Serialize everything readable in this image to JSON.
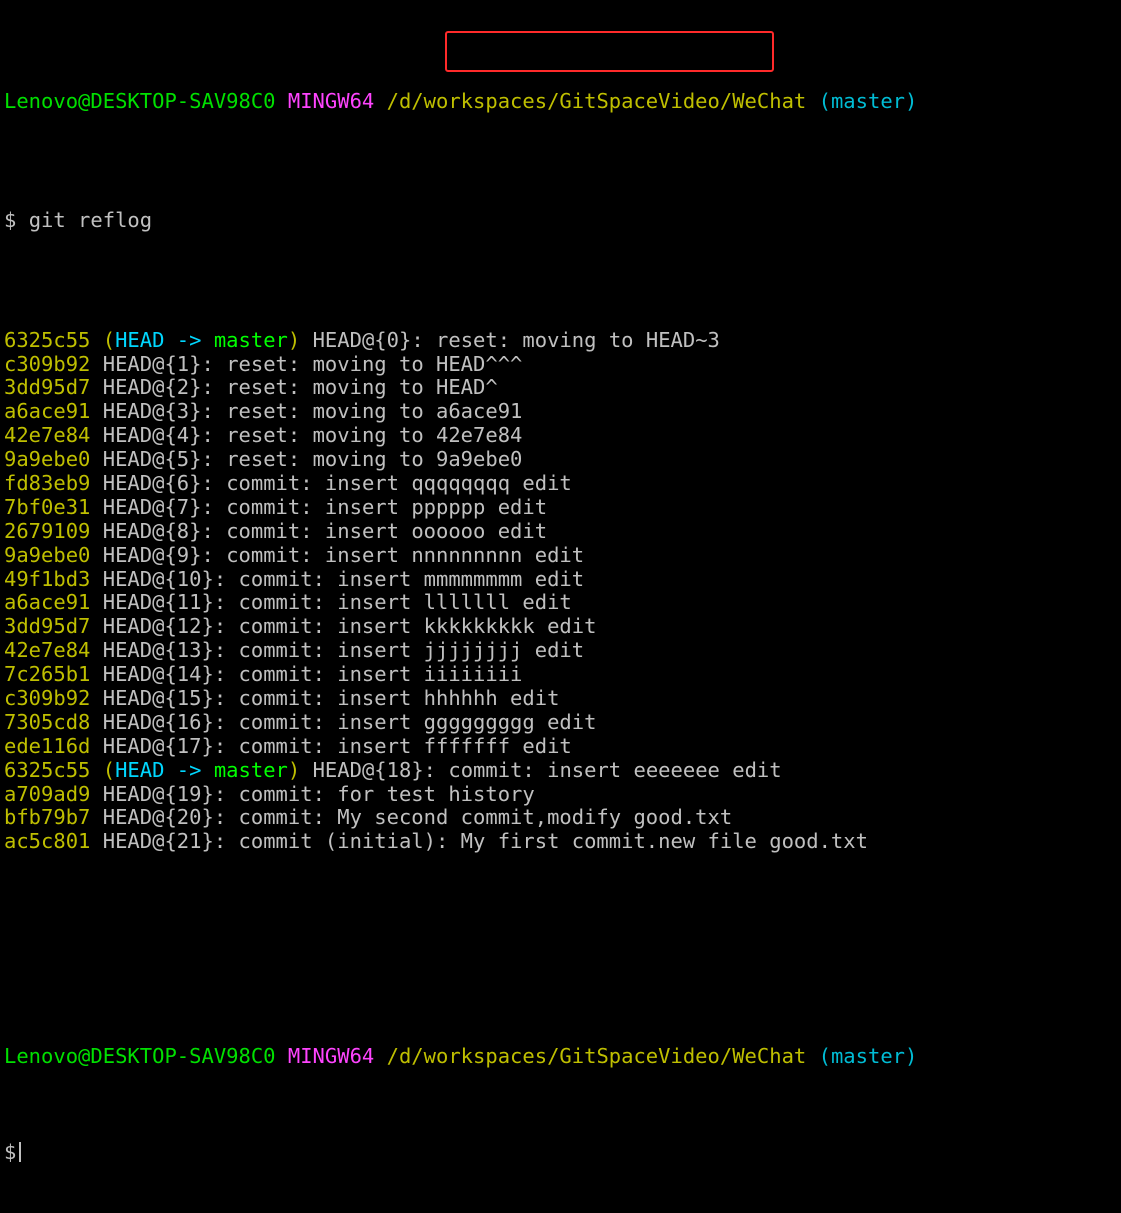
{
  "prompt": {
    "user_host": "Lenovo@DESKTOP-SAV98C0",
    "system": "MINGW64",
    "path": "/d/workspaces/GitSpaceVideo/WeChat",
    "branch": "(master)",
    "symbol": "$"
  },
  "command": "git reflog",
  "reflog": [
    {
      "hash": "6325c55",
      "decoration": {
        "open": "(",
        "head": "HEAD",
        "arrow": " -> ",
        "branch": "master",
        "close": ")"
      },
      "ref": "HEAD@{0}:",
      "message": "reset: moving to HEAD~3"
    },
    {
      "hash": "c309b92",
      "ref": "HEAD@{1}:",
      "message": "reset: moving to HEAD^^^"
    },
    {
      "hash": "3dd95d7",
      "ref": "HEAD@{2}:",
      "message": "reset: moving to HEAD^"
    },
    {
      "hash": "a6ace91",
      "ref": "HEAD@{3}:",
      "message": "reset: moving to a6ace91"
    },
    {
      "hash": "42e7e84",
      "ref": "HEAD@{4}:",
      "message": "reset: moving to 42e7e84"
    },
    {
      "hash": "9a9ebe0",
      "ref": "HEAD@{5}:",
      "message": "reset: moving to 9a9ebe0"
    },
    {
      "hash": "fd83eb9",
      "ref": "HEAD@{6}:",
      "message": "commit: insert qqqqqqqq edit"
    },
    {
      "hash": "7bf0e31",
      "ref": "HEAD@{7}:",
      "message": "commit: insert pppppp edit"
    },
    {
      "hash": "2679109",
      "ref": "HEAD@{8}:",
      "message": "commit: insert oooooo edit"
    },
    {
      "hash": "9a9ebe0",
      "ref": "HEAD@{9}:",
      "message": "commit: insert nnnnnnnnn edit"
    },
    {
      "hash": "49f1bd3",
      "ref": "HEAD@{10}:",
      "message": "commit: insert mmmmmmmm edit"
    },
    {
      "hash": "a6ace91",
      "ref": "HEAD@{11}:",
      "message": "commit: insert lllllll edit"
    },
    {
      "hash": "3dd95d7",
      "ref": "HEAD@{12}:",
      "message": "commit: insert kkkkkkkkk edit"
    },
    {
      "hash": "42e7e84",
      "ref": "HEAD@{13}:",
      "message": "commit: insert jjjjjjjj edit"
    },
    {
      "hash": "7c265b1",
      "ref": "HEAD@{14}:",
      "message": "commit: insert iiiiiiii"
    },
    {
      "hash": "c309b92",
      "ref": "HEAD@{15}:",
      "message": "commit: insert hhhhhh edit"
    },
    {
      "hash": "7305cd8",
      "ref": "HEAD@{16}:",
      "message": "commit: insert ggggggggg edit"
    },
    {
      "hash": "ede116d",
      "ref": "HEAD@{17}:",
      "message": "commit: insert fffffff edit"
    },
    {
      "hash": "6325c55",
      "decoration": {
        "open": "(",
        "head": "HEAD",
        "arrow": " -> ",
        "branch": "master",
        "close": ")"
      },
      "ref": "HEAD@{18}:",
      "message": "commit: insert eeeeeee edit"
    },
    {
      "hash": "a709ad9",
      "ref": "HEAD@{19}:",
      "message": "commit: for test history"
    },
    {
      "hash": "bfb79b7",
      "ref": "HEAD@{20}:",
      "message": "commit: My second commit,modify good.txt"
    },
    {
      "hash": "ac5c801",
      "ref": "HEAD@{21}:",
      "message": "commit (initial): My first commit.new file good.txt"
    }
  ],
  "colors": {
    "background": "#000000",
    "text": "#c0c0c0",
    "hash": "#bfbf00",
    "head": "#00d7ff",
    "branch": "#00ff00",
    "prompt_user": "#00e000",
    "prompt_system": "#ff44ff",
    "prompt_path": "#bfbf00",
    "prompt_branch": "#00bcd4",
    "highlight": "#ff2a2a"
  }
}
